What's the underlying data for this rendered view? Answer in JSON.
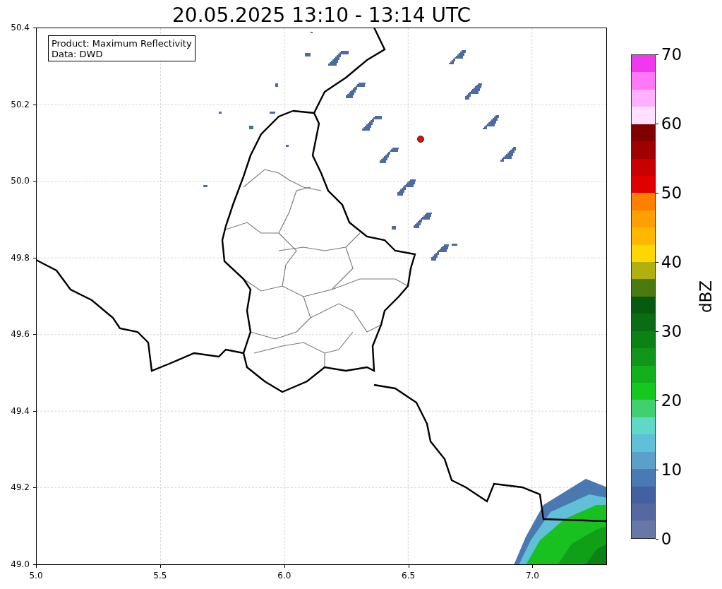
{
  "title": "20.05.2025 13:10 - 13:14 UTC",
  "legend": [
    "Product: Maximum Reflectivity",
    "Data: DWD"
  ],
  "y_axis": {
    "ticks": [
      "50.4",
      "50.2",
      "50.0",
      "49.8",
      "49.6",
      "49.4",
      "49.2",
      "49.0"
    ]
  },
  "x_axis": {
    "ticks": [
      "5.0",
      "5.5",
      "6.0",
      "6.5",
      "7.0"
    ]
  },
  "colorbar": {
    "label": "dBZ",
    "ticks": [
      "70",
      "60",
      "50",
      "40",
      "30",
      "20",
      "10",
      "0"
    ],
    "segments": [
      {
        "color": "#f038ee"
      },
      {
        "color": "#ff78f8"
      },
      {
        "color": "#ffb0ff"
      },
      {
        "color": "#ffe0ff"
      },
      {
        "color": "#800000"
      },
      {
        "color": "#a00000"
      },
      {
        "color": "#c80000"
      },
      {
        "color": "#e00000"
      },
      {
        "color": "#ff8000"
      },
      {
        "color": "#ffa000"
      },
      {
        "color": "#ffb800"
      },
      {
        "color": "#ffd700"
      },
      {
        "color": "#b0b010"
      },
      {
        "color": "#4a7a10"
      },
      {
        "color": "#085a10"
      },
      {
        "color": "#0a6c14"
      },
      {
        "color": "#0c8214"
      },
      {
        "color": "#10961a"
      },
      {
        "color": "#12b01c"
      },
      {
        "color": "#14c820"
      },
      {
        "color": "#40d070"
      },
      {
        "color": "#60d8c8"
      },
      {
        "color": "#60c0d8"
      },
      {
        "color": "#5aa0c8"
      },
      {
        "color": "#4a7ab2"
      },
      {
        "color": "#4460a0"
      },
      {
        "color": "#5568a0"
      },
      {
        "color": "#6677a8"
      }
    ]
  }
}
